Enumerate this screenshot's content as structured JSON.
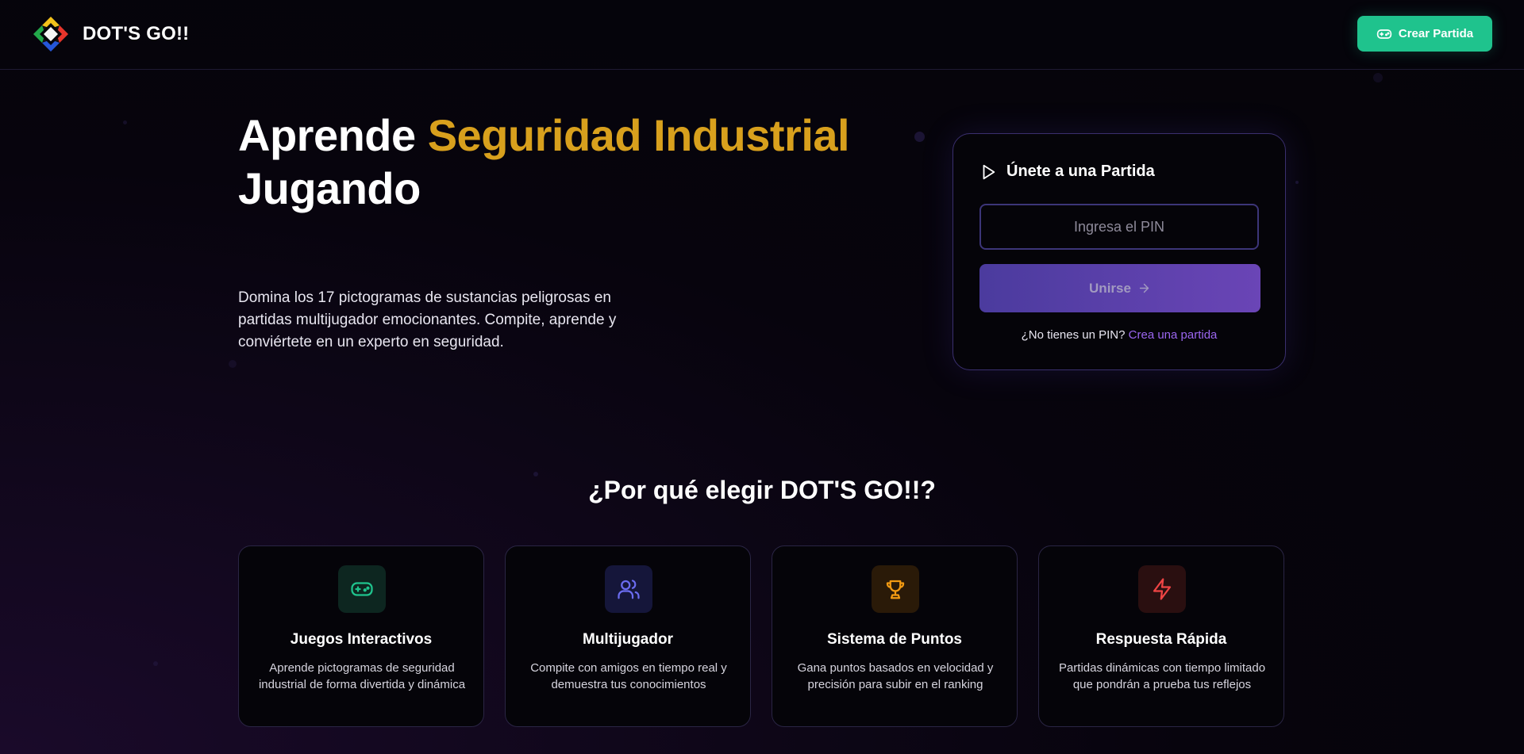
{
  "brand": {
    "name": "DOT'S GO!!"
  },
  "header": {
    "create_button_label": "Crear Partida",
    "create_button_icon": "gamepad-icon"
  },
  "hero": {
    "title_part1": "Aprende ",
    "title_accent": "Seguridad Industrial",
    "title_part2": "Jugando",
    "description": "Domina los 17 pictogramas de sustancias peligrosas en partidas multijugador emocionantes. Compite, aprende y conviértete en un experto en seguridad."
  },
  "join": {
    "title": "Únete a una Partida",
    "title_icon": "play-icon",
    "pin_placeholder": "Ingresa el PIN",
    "pin_value": "",
    "join_button_label": "Unirse",
    "no_pin_text": "¿No tienes un PIN?",
    "create_link_label": "Crea una partida"
  },
  "features": {
    "title": "¿Por qué elegir DOT'S GO!!?",
    "items": [
      {
        "name": "Juegos Interactivos",
        "description": "Aprende pictogramas de seguridad industrial de forma divertida y dinámica",
        "icon": "gamepad-icon",
        "color": "#1fc38d"
      },
      {
        "name": "Multijugador",
        "description": "Compite con amigos en tiempo real y demuestra tus conocimientos",
        "icon": "users-icon",
        "color": "#6b6cf0"
      },
      {
        "name": "Sistema de Puntos",
        "description": "Gana puntos basados en velocidad y precisión para subir en el ranking",
        "icon": "trophy-icon",
        "color": "#f29a12"
      },
      {
        "name": "Respuesta Rápida",
        "description": "Partidas dinámicas con tiempo limitado que pondrán a prueba tus reflejos",
        "icon": "lightning-icon",
        "color": "#ef4444"
      }
    ]
  },
  "colors": {
    "accent_gold": "#d8a01d",
    "primary_green": "#1fc38d",
    "primary_purple": "#5a40b0",
    "link_purple": "#9b66f0",
    "background": "#07040d"
  }
}
